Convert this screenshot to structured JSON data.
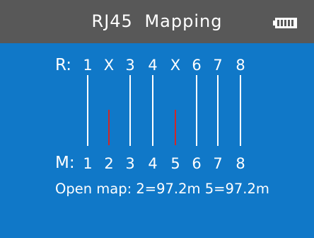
{
  "header": {
    "title": "RJ45  Mapping",
    "battery_icon": "battery-full-icon"
  },
  "mapping": {
    "r_label": "R:",
    "m_label": "M:",
    "r_pins": [
      "1",
      "X",
      "3",
      "4",
      "X",
      "6",
      "7",
      "8"
    ],
    "m_pins": [
      "1",
      "2",
      "3",
      "4",
      "5",
      "6",
      "7",
      "8"
    ],
    "wire_status": [
      "connected",
      "open",
      "connected",
      "connected",
      "open",
      "connected",
      "connected",
      "connected"
    ],
    "colors": {
      "connected": "#ffffff",
      "open": "#d02828"
    }
  },
  "status": {
    "open_map_text": "Open map: 2=97.2m  5=97.2m"
  },
  "colors": {
    "background": "#1078c8",
    "titlebar": "#585858"
  }
}
